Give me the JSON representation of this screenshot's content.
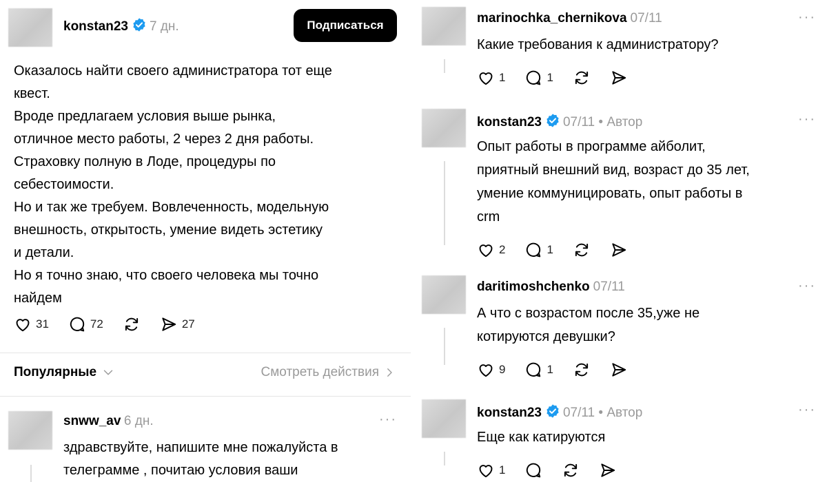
{
  "post": {
    "author": "konstan23",
    "time": "7 дн.",
    "subscribe_label": "Подписаться",
    "lines": [
      "Оказалось найти своего администратора тот еще",
      "квест.",
      "Вроде предлагаем условия выше рынка,",
      "отличное место работы, 2 через 2 дня работы.",
      "Страховку полную в Лоде, процедуры по",
      "себестоимости.",
      "Но и так же требуем. Вовлеченность, модельную",
      "внешность, открытость, умение видеть эстетику",
      "и детали.",
      "Но я точно знаю, что своего человека мы точно",
      "найдем"
    ],
    "likes": "31",
    "replies": "72",
    "shares": "27"
  },
  "filter": {
    "sort_label": "Популярные",
    "activity_label": "Смотреть действия"
  },
  "left_reply": {
    "author": "snww_av",
    "time": "6 дн.",
    "lines": [
      "здравствуйте, напишите мне пожалуйста в",
      "телеграмме , почитаю условия ваши"
    ]
  },
  "comments": [
    {
      "author": "marinochka_chernikova",
      "time": "07/11",
      "verified": false,
      "author_tag": "",
      "lines": [
        "Какие требования к администратору?"
      ],
      "likes": "1",
      "replies": "1"
    },
    {
      "author": "konstan23",
      "time": "07/11",
      "verified": true,
      "author_tag": "Автор",
      "lines": [
        "Опыт работы в программе айболит,",
        "приятный внешний вид, возраст до 35 лет,",
        "умение коммуницировать, опыт работы в",
        "crm"
      ],
      "likes": "2",
      "replies": "1"
    },
    {
      "author": "daritimoshchenko",
      "time": "07/11",
      "verified": false,
      "author_tag": "",
      "lines": [
        "А что с возрастом после 35,уже не",
        "котируются девушки?"
      ],
      "likes": "9",
      "replies": "1"
    },
    {
      "author": "konstan23",
      "time": "07/11",
      "verified": true,
      "author_tag": "Автор",
      "lines": [
        "Еще как катируются"
      ],
      "likes": "1",
      "replies": ""
    }
  ],
  "icons": {
    "like": "heart-icon",
    "reply": "speech-bubble-icon",
    "repost": "repost-icon",
    "share": "send-icon",
    "verified": "verified-badge-icon",
    "more": "more-dots-icon"
  },
  "colors": {
    "verified": "#1d9bf0",
    "muted": "#9a9a9a",
    "button_bg": "#000000"
  }
}
